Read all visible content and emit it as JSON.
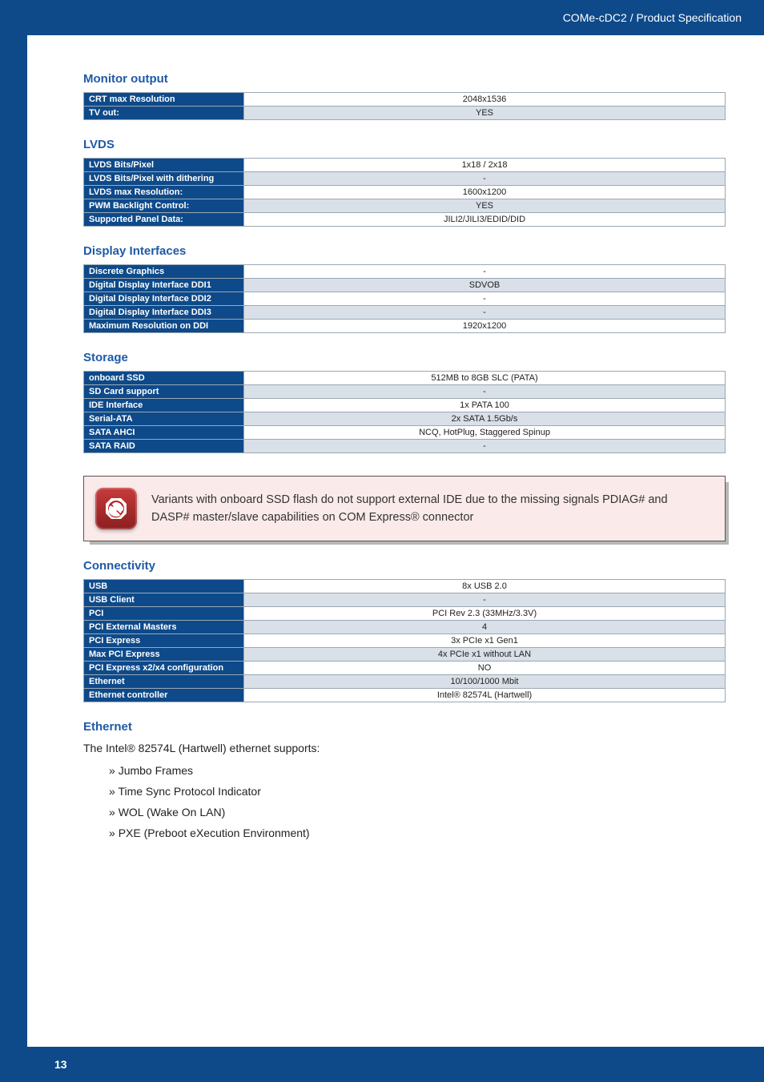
{
  "header": {
    "title": "COMe-cDC2 / Product Specification"
  },
  "sections": {
    "monitor_output": {
      "heading": "Monitor output",
      "rows": [
        {
          "label": "CRT max Resolution",
          "value": "2048x1536",
          "shade": false
        },
        {
          "label": "TV out:",
          "value": "YES",
          "shade": true
        }
      ]
    },
    "lvds": {
      "heading": "LVDS",
      "rows": [
        {
          "label": "LVDS Bits/Pixel",
          "value": "1x18 / 2x18",
          "shade": false
        },
        {
          "label": "LVDS Bits/Pixel with dithering",
          "value": "-",
          "shade": true
        },
        {
          "label": "LVDS max Resolution:",
          "value": "1600x1200",
          "shade": false
        },
        {
          "label": "PWM Backlight Control:",
          "value": "YES",
          "shade": true
        },
        {
          "label": "Supported Panel Data:",
          "value": "JILI2/JILI3/EDID/DID",
          "shade": false
        }
      ]
    },
    "display_interfaces": {
      "heading": "Display Interfaces",
      "rows": [
        {
          "label": "Discrete Graphics",
          "value": "-",
          "shade": false
        },
        {
          "label": "Digital Display Interface DDI1",
          "value": "SDVOB",
          "shade": true
        },
        {
          "label": "Digital Display Interface DDI2",
          "value": "-",
          "shade": false
        },
        {
          "label": "Digital Display Interface DDI3",
          "value": "-",
          "shade": true
        },
        {
          "label": "Maximum Resolution on DDI",
          "value": "1920x1200",
          "shade": false
        }
      ]
    },
    "storage": {
      "heading": "Storage",
      "rows": [
        {
          "label": "onboard SSD",
          "value": "512MB to 8GB SLC (PATA)",
          "shade": false
        },
        {
          "label": "SD Card support",
          "value": "-",
          "shade": true
        },
        {
          "label": "IDE Interface",
          "value": "1x PATA 100",
          "shade": false
        },
        {
          "label": "Serial-ATA",
          "value": "2x SATA 1.5Gb/s",
          "shade": true
        },
        {
          "label": "SATA AHCI",
          "value": "NCQ, HotPlug, Staggered Spinup",
          "shade": false
        },
        {
          "label": "SATA RAID",
          "value": "-",
          "shade": true
        }
      ]
    },
    "connectivity": {
      "heading": "Connectivity",
      "rows": [
        {
          "label": "USB",
          "value": "8x USB 2.0",
          "shade": false
        },
        {
          "label": "USB Client",
          "value": "-",
          "shade": true
        },
        {
          "label": "PCI",
          "value": "PCI Rev 2.3 (33MHz/3.3V)",
          "shade": false
        },
        {
          "label": "PCI External Masters",
          "value": "4",
          "shade": true
        },
        {
          "label": "PCI Express",
          "value": "3x PCIe x1 Gen1",
          "shade": false
        },
        {
          "label": "Max PCI Express",
          "value": "4x PCIe x1 without LAN",
          "shade": true
        },
        {
          "label": "PCI Express x2/x4 configuration",
          "value": "NO",
          "shade": false
        },
        {
          "label": "Ethernet",
          "value": "10/100/1000 Mbit",
          "shade": true
        },
        {
          "label": "Ethernet controller",
          "value": "Intel® 82574L (Hartwell)",
          "shade": false
        }
      ]
    },
    "ethernet": {
      "heading": "Ethernet",
      "intro": "The Intel® 82574L (Hartwell) ethernet supports:",
      "items": [
        "Jumbo Frames",
        "Time Sync Protocol Indicator",
        "WOL (Wake On LAN)",
        "PXE (Preboot eXecution Environment)"
      ]
    }
  },
  "callout": {
    "text": "Variants with onboard SSD flash do not support external IDE due to the missing signals PDIAG# and DASP# master/slave capabilities on COM Express® connector"
  },
  "footer": {
    "page": "13"
  }
}
